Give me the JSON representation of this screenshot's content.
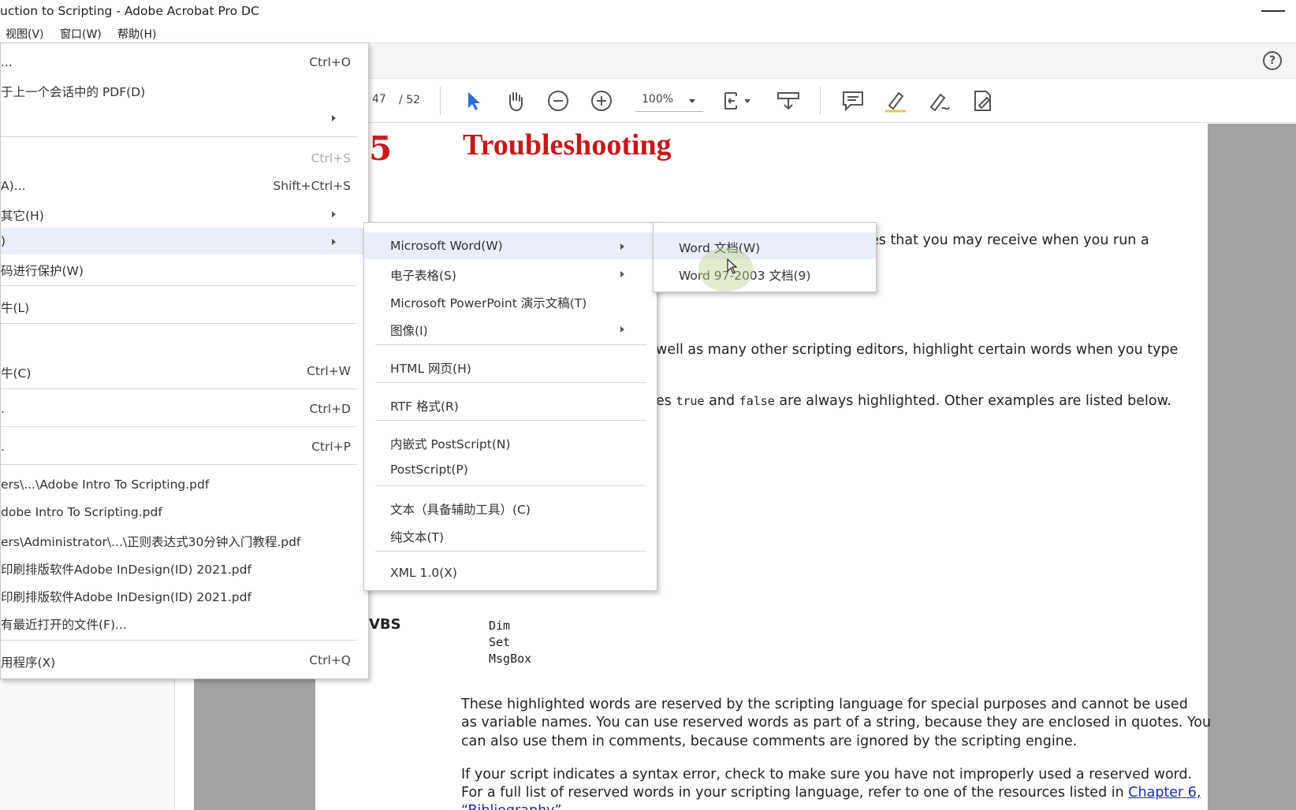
{
  "window": {
    "title": "uction to Scripting - Adobe Acrobat Pro DC"
  },
  "menubar": [
    "视图(V)",
    "窗口(W)",
    "帮助(H)"
  ],
  "toolbar": {
    "page_current": "47",
    "page_total": "/ 52",
    "zoom": "100%",
    "icons": [
      "select-arrow-icon",
      "hand-icon",
      "zoom-out-icon",
      "zoom-in-icon",
      "fit-page-icon",
      "scroll-mode-icon",
      "comment-icon",
      "highlight-icon",
      "sign-icon",
      "fill-sign-icon"
    ]
  },
  "file_menu": {
    "items": [
      {
        "label": "...",
        "shortcut": "Ctrl+O"
      },
      {
        "label": "于上一个会话中的 PDF(D)",
        "shortcut": ""
      },
      {
        "label": "",
        "shortcut": ""
      },
      {
        "label": "",
        "shortcut": "Ctrl+S"
      },
      {
        "label": "A)...",
        "shortcut": "Shift+Ctrl+S"
      },
      {
        "label": "其它(H)",
        "shortcut": ""
      },
      {
        "label": ")",
        "shortcut": ""
      },
      {
        "label": "码进行保护(W)",
        "shortcut": ""
      },
      {
        "label": "牛(L)",
        "shortcut": ""
      },
      {
        "label": "",
        "shortcut": ""
      },
      {
        "label": "牛(C)",
        "shortcut": "Ctrl+W"
      },
      {
        "label": ".",
        "shortcut": "Ctrl+D"
      },
      {
        "label": ".",
        "shortcut": "Ctrl+P"
      },
      {
        "label": "ers\\...\\Adobe Intro To Scripting.pdf",
        "shortcut": ""
      },
      {
        "label": "dobe Intro To Scripting.pdf",
        "shortcut": ""
      },
      {
        "label": "ers\\Administrator\\...\\正则表达式30分钟入门教程.pdf",
        "shortcut": ""
      },
      {
        "label": "印刷排版软件Adobe InDesign(ID) 2021.pdf",
        "shortcut": ""
      },
      {
        "label": "印刷排版软件Adobe InDesign(ID) 2021.pdf",
        "shortcut": ""
      },
      {
        "label": "有最近打开的文件(F)...",
        "shortcut": ""
      },
      {
        "label": "用程序(X)",
        "shortcut": "Ctrl+Q"
      }
    ]
  },
  "submenu_export": {
    "items": [
      "Microsoft Word(W)",
      "电子表格(S)",
      "Microsoft PowerPoint 演示文稿(T)",
      "图像(I)",
      "HTML 网页(H)",
      "RTF 格式(R)",
      "内嵌式 PostScript(N)",
      "PostScript(P)",
      "文本（具备辅助工具）(C)",
      "纯文本(T)",
      "XML 1.0(X)"
    ]
  },
  "submenu_word": {
    "items": [
      "Word 文档(W)",
      "Word 97-2003 文档(9)"
    ]
  },
  "document": {
    "chapter_number": "5",
    "chapter_title": "Troubleshooting",
    "p1_tail": "es that you may receive when you run a",
    "p2_tail": "well as many other scripting editors, highlight certain words when you type",
    "p3_prefix": "es",
    "p3_true": "true",
    "p3_and": "and",
    "p3_false": "false",
    "p3_suffix": "are always highlighted. Other examples are listed below.",
    "vbs_label": "VBS",
    "vbs_words": [
      "Dim",
      "Set",
      "MsgBox"
    ],
    "para4": [
      "These highlighted words are reserved by the scripting language for special purposes and cannot be used",
      "as variable names. You can use reserved words as part of a string, because they are enclosed in quotes. You",
      "can also use them in comments, because comments are ignored by the scripting engine."
    ],
    "para5_line1": "If your script indicates a syntax error, check to make sure you have not improperly used a reserved word.",
    "para5_line2": "For a full list of reserved words in your scripting language, refer to one of the resources listed in",
    "para5_link": "Chapter 6,",
    "para5_line3": "“Bibliography”"
  }
}
